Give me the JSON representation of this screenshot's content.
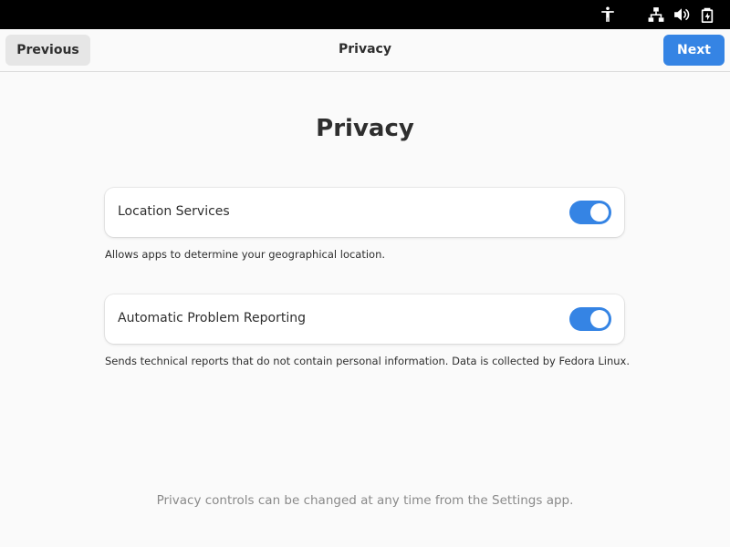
{
  "status_bar": {
    "icons": [
      "accessibility-icon",
      "network-icon",
      "volume-icon",
      "battery-icon"
    ]
  },
  "header": {
    "previous_label": "Previous",
    "title": "Privacy",
    "next_label": "Next"
  },
  "main": {
    "title": "Privacy",
    "settings": [
      {
        "label": "Location Services",
        "enabled": true,
        "description": "Allows apps to determine your geographical location."
      },
      {
        "label": "Automatic Problem Reporting",
        "enabled": true,
        "description": "Sends technical reports that do not contain personal information. Data is collected by Fedora Linux."
      }
    ],
    "footer_note": "Privacy controls can be changed at any time from the Settings app."
  },
  "colors": {
    "accent": "#3584e4",
    "topbar": "#000000",
    "background": "#fafafa"
  }
}
